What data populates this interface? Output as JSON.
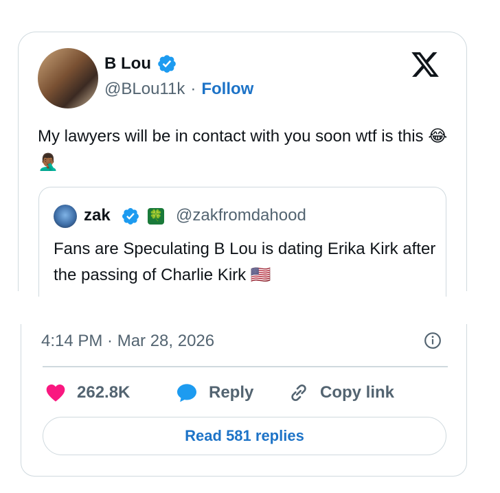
{
  "tweet": {
    "author_name": "B Lou",
    "author_handle": "@BLou11k",
    "separator": "·",
    "follow_label": "Follow",
    "text": "My lawyers will be in contact with you soon wtf is this 😂🤦🏾‍♂️"
  },
  "quote": {
    "author_name": "zak",
    "badge": "🍀",
    "author_handle": "@zakfromdahood",
    "text": "Fans are Speculating B Lou is dating Erika Kirk after the passing of Charlie Kirk 🇺🇸"
  },
  "meta": {
    "timestamp": "4:14 PM · Mar 28, 2026"
  },
  "actions": {
    "like_count": "262.8K",
    "reply_label": "Reply",
    "copy_label": "Copy link"
  },
  "read_replies_label": "Read 581 replies",
  "colors": {
    "accent": "#1d9bf0",
    "link": "#1d73c7",
    "like": "#f91880",
    "border": "#cfd9de",
    "muted": "#536471"
  },
  "icons": [
    "verified-badge-icon",
    "x-logo-icon",
    "heart-icon",
    "reply-bubble-icon",
    "link-icon",
    "info-icon"
  ]
}
